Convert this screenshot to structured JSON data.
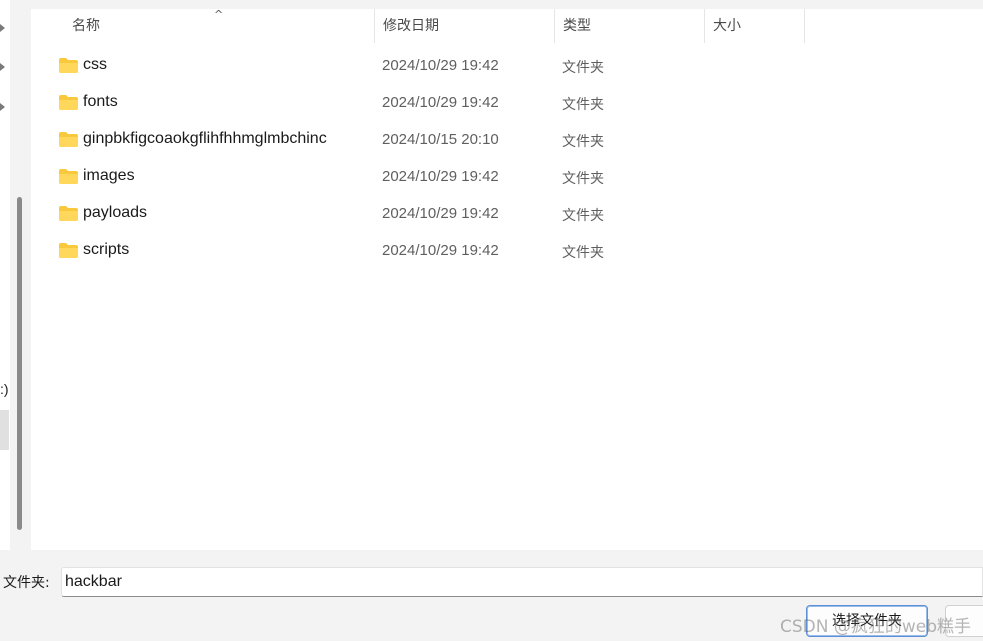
{
  "nav": {
    "drive_fragment": ":)"
  },
  "columns": {
    "name": "名称",
    "date_modified": "修改日期",
    "type": "类型",
    "size": "大小",
    "sort_indicator": "^"
  },
  "files": [
    {
      "name": "css",
      "date": "2024/10/29 19:42",
      "type": "文件夹",
      "icon": "folder-icon"
    },
    {
      "name": "fonts",
      "date": "2024/10/29 19:42",
      "type": "文件夹",
      "icon": "folder-icon"
    },
    {
      "name": "ginpbkfigcoaokgflihfhhmglmbchinc",
      "date": "2024/10/15 20:10",
      "type": "文件夹",
      "icon": "folder-icon"
    },
    {
      "name": "images",
      "date": "2024/10/29 19:42",
      "type": "文件夹",
      "icon": "folder-icon"
    },
    {
      "name": "payloads",
      "date": "2024/10/29 19:42",
      "type": "文件夹",
      "icon": "folder-icon"
    },
    {
      "name": "scripts",
      "date": "2024/10/29 19:42",
      "type": "文件夹",
      "icon": "folder-icon"
    }
  ],
  "footer": {
    "folder_label": "文件夹:",
    "folder_value": "hackbar",
    "select_button": "选择文件夹"
  },
  "watermark": "CSDN @疯狂的web糕手",
  "colors": {
    "folder": "#f8c93d",
    "accent_border": "#5b8fd6"
  }
}
